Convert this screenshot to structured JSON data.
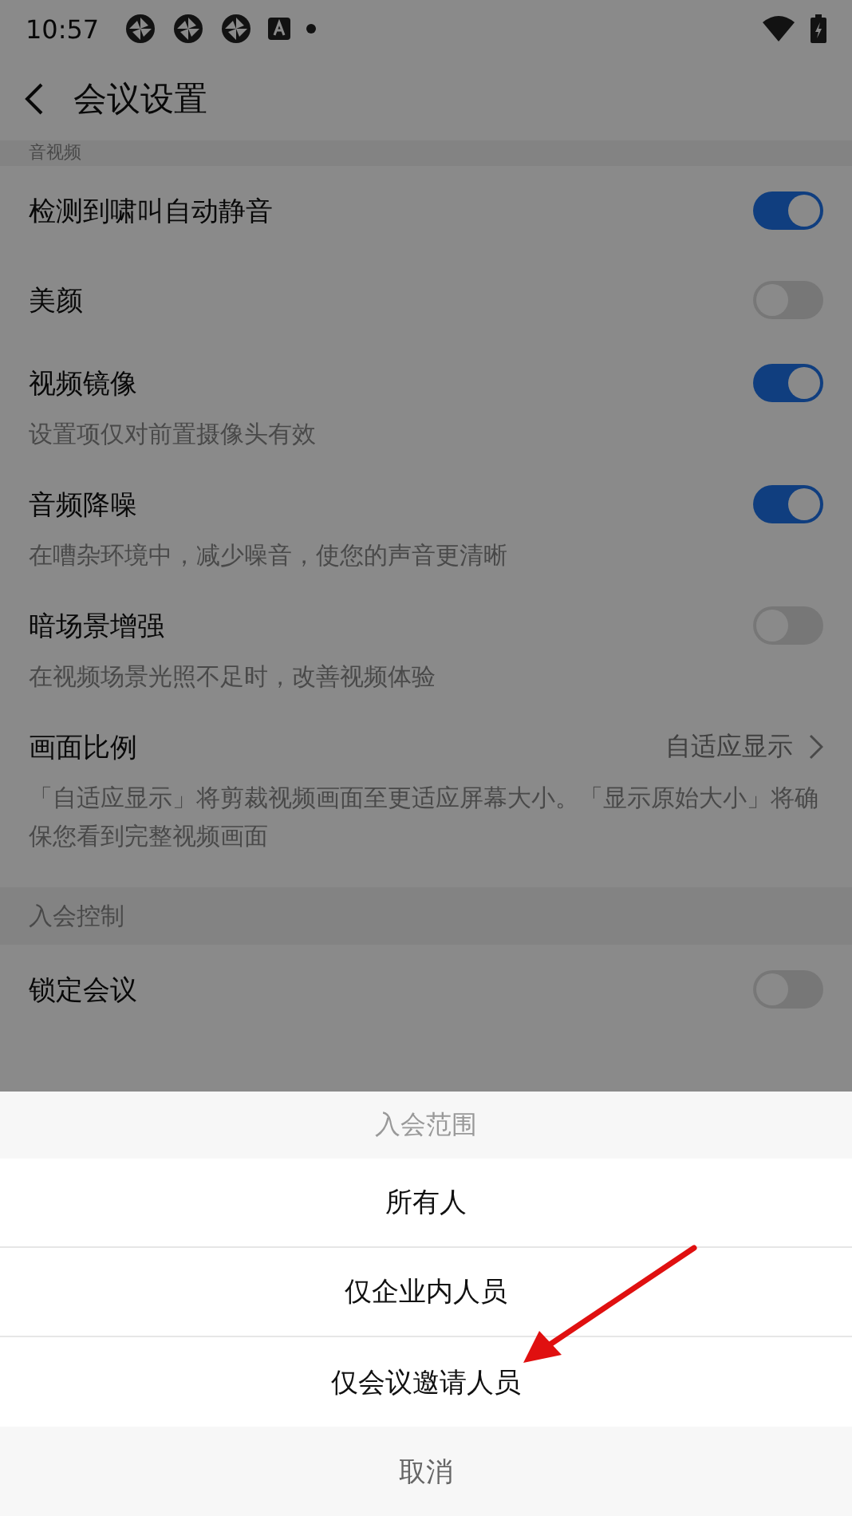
{
  "status_bar": {
    "time": "10:57"
  },
  "header": {
    "title": "会议设置"
  },
  "sections": [
    {
      "header": "音视频",
      "items": [
        {
          "kind": "toggle",
          "label": "检测到啸叫自动静音",
          "on": true
        },
        {
          "kind": "toggle",
          "label": "美颜",
          "on": false
        },
        {
          "kind": "toggle",
          "label": "视频镜像",
          "on": true,
          "description": "设置项仅对前置摄像头有效"
        },
        {
          "kind": "toggle",
          "label": "音频降噪",
          "on": true,
          "description": "在嘈杂环境中，减少噪音，使您的声音更清晰"
        },
        {
          "kind": "toggle",
          "label": "暗场景增强",
          "on": false,
          "description": "在视频场景光照不足时，改善视频体验"
        },
        {
          "kind": "select",
          "label": "画面比例",
          "value": "自适应显示",
          "description": "「自适应显示」将剪裁视频画面至更适应屏幕大小。「显示原始大小」将确保您看到完整视频画面"
        }
      ]
    },
    {
      "header": "入会控制",
      "items": [
        {
          "kind": "toggle",
          "label": "锁定会议",
          "on": false
        }
      ]
    }
  ],
  "sheet": {
    "title": "入会范围",
    "options": [
      {
        "label": "所有人"
      },
      {
        "label": "仅企业内人员"
      },
      {
        "label": "仅会议邀请人员"
      }
    ],
    "cancel": "取消"
  }
}
